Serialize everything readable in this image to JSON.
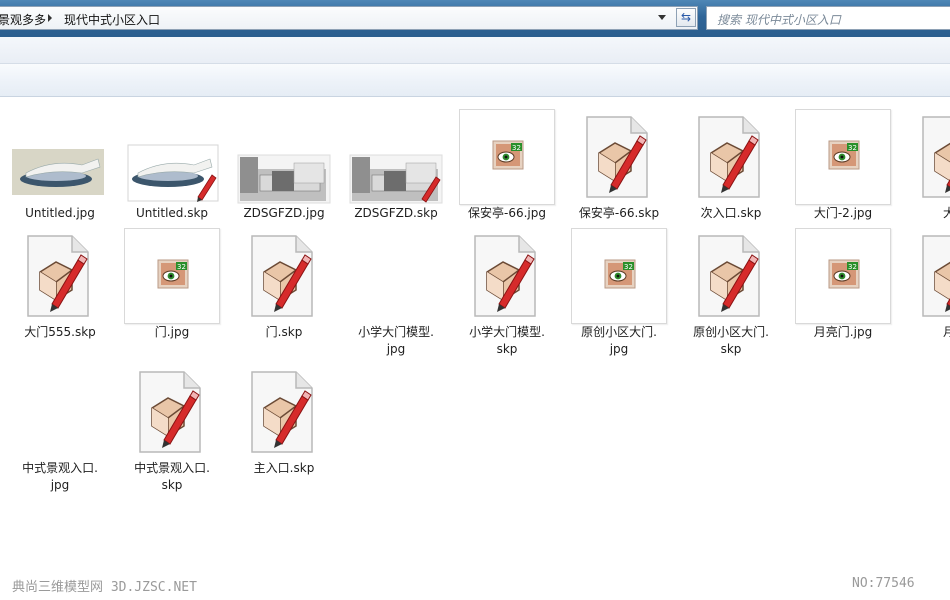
{
  "address": {
    "crumbs": [
      "景观多多",
      "现代中式小区入口"
    ]
  },
  "search": {
    "placeholder": "搜索 现代中式小区入口"
  },
  "files": [
    {
      "label": "Untitled.jpg",
      "kind": "photo-plaza"
    },
    {
      "label": "Untitled.skp",
      "kind": "skp-plaza"
    },
    {
      "label": "ZDSGFZD.jpg",
      "kind": "photo-building"
    },
    {
      "label": "ZDSGFZD.skp",
      "kind": "skp-building"
    },
    {
      "label": "保安亭-66.jpg",
      "kind": "jpg"
    },
    {
      "label": "保安亭-66.skp",
      "kind": "skp"
    },
    {
      "label": "次入口.skp",
      "kind": "skp"
    },
    {
      "label": "大门-2.jpg",
      "kind": "jpg"
    },
    {
      "label": "大门",
      "kind": "skp"
    },
    {
      "label": "大门555.skp",
      "kind": "skp"
    },
    {
      "label": "门.jpg",
      "kind": "jpg"
    },
    {
      "label": "门.skp",
      "kind": "skp"
    },
    {
      "label": "小学大门模型.\njpg",
      "kind": "blank"
    },
    {
      "label": "小学大门模型.\nskp",
      "kind": "skp"
    },
    {
      "label": "原创小区大门.\njpg",
      "kind": "jpg"
    },
    {
      "label": "原创小区大门.\nskp",
      "kind": "skp"
    },
    {
      "label": "月亮门.jpg",
      "kind": "jpg"
    },
    {
      "label": "月亮",
      "kind": "skp"
    },
    {
      "label": "中式景观入口.\njpg",
      "kind": "blank"
    },
    {
      "label": "中式景观入口.\nskp",
      "kind": "skp"
    },
    {
      "label": "主入口.skp",
      "kind": "skp"
    }
  ],
  "watermark": {
    "left": "典尚三维模型网 3D.JZSC.NET",
    "right": "NO:77546"
  }
}
